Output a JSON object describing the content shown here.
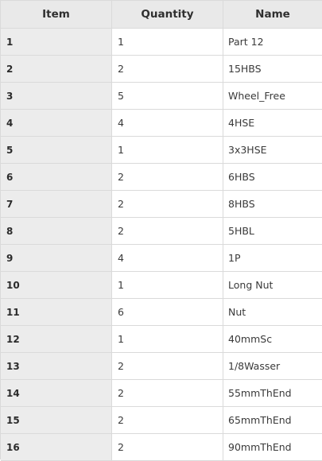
{
  "table": {
    "headers": {
      "item": "Item",
      "quantity": "Quantity",
      "name": "Name"
    },
    "rows": [
      {
        "item": "1",
        "quantity": "1",
        "name": "Part 12"
      },
      {
        "item": "2",
        "quantity": "2",
        "name": "15HBS"
      },
      {
        "item": "3",
        "quantity": "5",
        "name": "Wheel_Free"
      },
      {
        "item": "4",
        "quantity": "4",
        "name": "4HSE"
      },
      {
        "item": "5",
        "quantity": "1",
        "name": "3x3HSE"
      },
      {
        "item": "6",
        "quantity": "2",
        "name": "6HBS"
      },
      {
        "item": "7",
        "quantity": "2",
        "name": "8HBS"
      },
      {
        "item": "8",
        "quantity": "2",
        "name": "5HBL"
      },
      {
        "item": "9",
        "quantity": "4",
        "name": "1P"
      },
      {
        "item": "10",
        "quantity": "1",
        "name": "Long Nut"
      },
      {
        "item": "11",
        "quantity": "6",
        "name": "Nut"
      },
      {
        "item": "12",
        "quantity": "1",
        "name": "40mmSc"
      },
      {
        "item": "13",
        "quantity": "2",
        "name": "1/8Wasser"
      },
      {
        "item": "14",
        "quantity": "2",
        "name": "55mmThEnd"
      },
      {
        "item": "15",
        "quantity": "2",
        "name": "65mmThEnd"
      },
      {
        "item": "16",
        "quantity": "2",
        "name": "90mmThEnd"
      }
    ]
  }
}
